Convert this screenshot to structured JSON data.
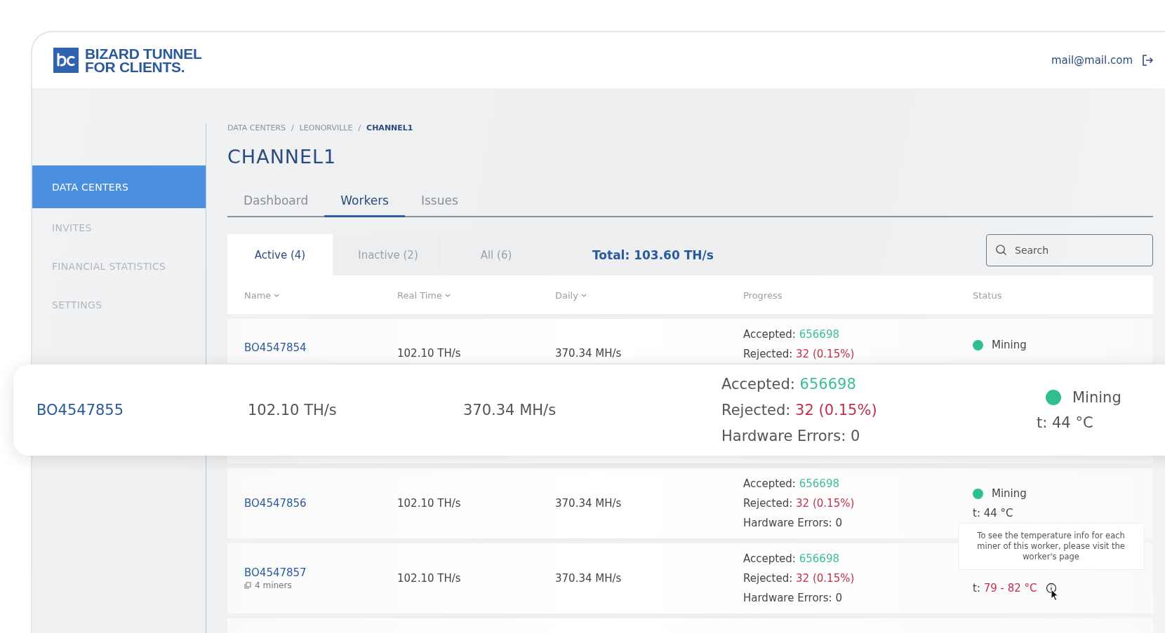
{
  "header": {
    "brand_line_1": "BIZARD TUNNEL",
    "brand_line_2": "FOR CLIENTS.",
    "user_email": "mail@mail.com"
  },
  "sidebar": {
    "items": [
      {
        "label": "DATA CENTERS",
        "selected": true
      },
      {
        "label": "INVITES",
        "selected": false
      },
      {
        "label": "FINANCIAL STATISTICS",
        "selected": false
      },
      {
        "label": "SETTINGS",
        "selected": false
      }
    ]
  },
  "breadcrumb": {
    "separator": "/",
    "items": [
      {
        "label": "DATA CENTERS",
        "current": false
      },
      {
        "label": "LEONORVILLE",
        "current": false
      },
      {
        "label": "CHANNEL1",
        "current": true
      }
    ]
  },
  "page_title": "CHANNEL1",
  "tabs": [
    {
      "label": "Dashboard",
      "selected": false
    },
    {
      "label": "Workers",
      "selected": true
    },
    {
      "label": "Issues",
      "selected": false
    }
  ],
  "filters": [
    {
      "label": "Active (4)",
      "selected": true
    },
    {
      "label": "Inactive (2)",
      "selected": false
    },
    {
      "label": "All (6)",
      "selected": false
    }
  ],
  "total": "Total: 103.60 TH/s",
  "search": {
    "placeholder": "Search"
  },
  "table": {
    "columns": [
      {
        "label": "Name",
        "sortable": true
      },
      {
        "label": "Real Time",
        "sortable": true
      },
      {
        "label": "Daily",
        "sortable": true
      },
      {
        "label": "Progress",
        "sortable": false
      },
      {
        "label": "Status",
        "sortable": false
      }
    ],
    "rows": [
      {
        "kind": "covered",
        "name": "BO4547854",
        "real_time": "102.10 TH/s",
        "daily": "370.34 MH/s",
        "progress": [
          {
            "label": "Accepted:",
            "value": "656698",
            "color": "#3cbf94"
          },
          {
            "label": "Rejected:",
            "value": "32 (0.15%)",
            "color": "#c0304a"
          }
        ],
        "status": {
          "label": "Mining",
          "color": "#2fbf8c"
        }
      },
      {
        "kind": "empty"
      },
      {
        "kind": "worker",
        "name": "BO4547856",
        "real_time": "102.10 TH/s",
        "daily": "370.34 MH/s",
        "progress": [
          {
            "label": "Accepted:",
            "value": "656698",
            "color": "#3cbf94"
          },
          {
            "label": "Rejected:",
            "value": "32 (0.15%)",
            "color": "#c0304a"
          },
          {
            "label": "Hardware Errors:",
            "value": "0",
            "color": "#444444"
          }
        ],
        "status": {
          "label": "Mining",
          "color": "#2fbf8c"
        },
        "temperature": {
          "label": "t:",
          "value": "44 °C",
          "alert": false
        }
      },
      {
        "kind": "worker",
        "name": "BO4547857",
        "miners": "4 miners",
        "real_time": "102.10 TH/s",
        "daily": "370.34 MH/s",
        "progress": [
          {
            "label": "Accepted:",
            "value": "656698",
            "color": "#3cbf94"
          },
          {
            "label": "Rejected:",
            "value": "32 (0.15%)",
            "color": "#c0304a"
          },
          {
            "label": "Hardware Errors:",
            "value": "0",
            "color": "#444444"
          }
        ],
        "temperature": {
          "label": "t:",
          "value": "79 - 82 °C",
          "alert": true,
          "tooltip": "To see the temperature info for each miner of this worker, please visit the worker's page"
        }
      },
      {
        "kind": "empty"
      }
    ]
  },
  "highlighted_row": {
    "name": "BO4547855",
    "real_time": "102.10 TH/s",
    "daily": "370.34 MH/s",
    "progress": [
      {
        "label": "Accepted:",
        "value": "656698",
        "color": "#3cbf94"
      },
      {
        "label": "Rejected:",
        "value": "32 (0.15%)",
        "color": "#c0304a"
      },
      {
        "label": "Hardware Errors:",
        "value": "0",
        "color": "#555555"
      }
    ],
    "status": {
      "label": "Mining",
      "color": "#2fbf8c"
    },
    "temperature": {
      "label": "t:",
      "value": "44 °C",
      "alert": false
    }
  }
}
